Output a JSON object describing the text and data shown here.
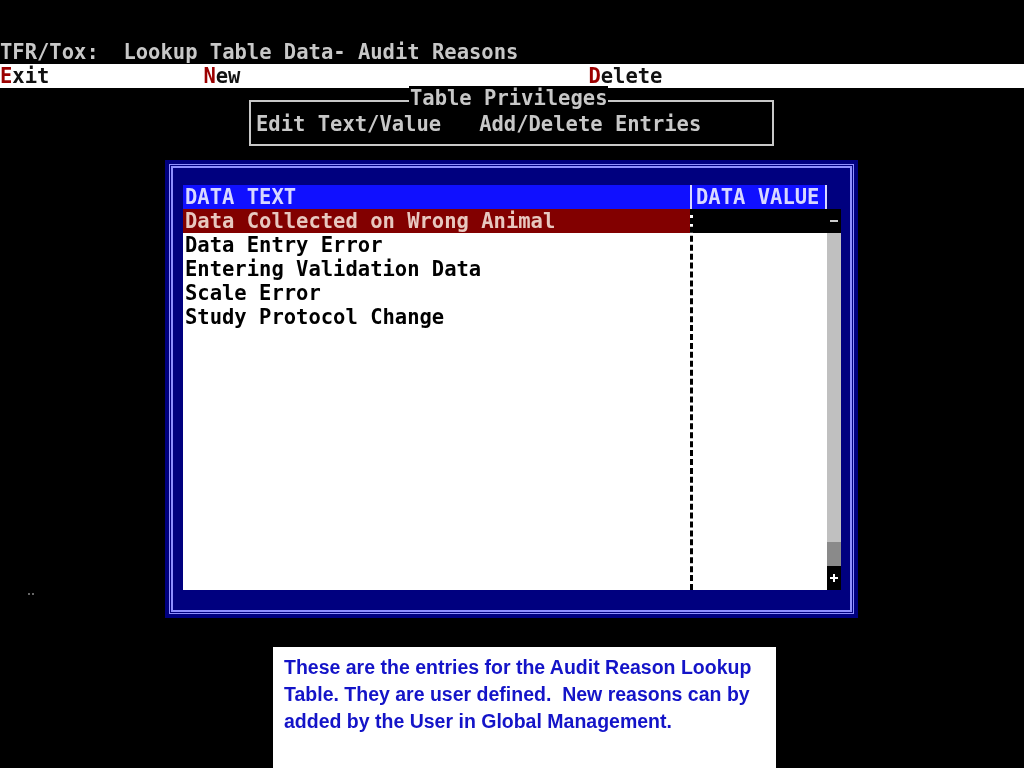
{
  "title": "TFR/Tox:  Lookup Table Data- Audit Reasons",
  "menu": [
    {
      "label": "Exit"
    },
    {
      "label": "New"
    },
    {
      "label": "Delete"
    }
  ],
  "privileges": {
    "title": "Table Privileges",
    "items": [
      "Edit Text/Value",
      "Add/Delete Entries"
    ]
  },
  "table": {
    "columns": [
      "DATA TEXT",
      "DATA VALUE"
    ],
    "rows": [
      {
        "text": "Data Collected on Wrong Animal",
        "selected": true
      },
      {
        "text": "Data Entry Error",
        "selected": false
      },
      {
        "text": "Entering Validation Data",
        "selected": false
      },
      {
        "text": "Scale Error",
        "selected": false
      },
      {
        "text": "Study Protocol Change",
        "selected": false
      }
    ]
  },
  "callout": "These are the entries for the Audit Reason Lookup Table. They are user defined.  New reasons can by added by the User in Global Management."
}
